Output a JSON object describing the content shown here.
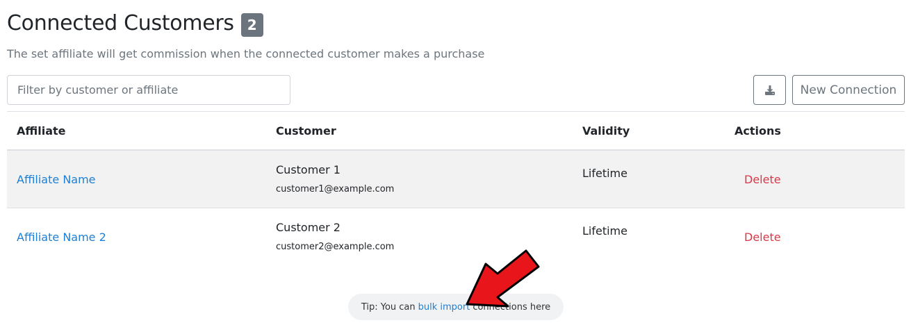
{
  "header": {
    "title": "Connected Customers",
    "count": "2",
    "subtitle": "The set affiliate will get commission when the connected customer makes a purchase"
  },
  "toolbar": {
    "filter_placeholder": "Filter by customer or affiliate",
    "download_icon": "download-icon",
    "new_connection_label": "New Connection"
  },
  "table": {
    "columns": [
      "Affiliate",
      "Customer",
      "Validity",
      "Actions"
    ],
    "rows": [
      {
        "affiliate": "Affiliate Name",
        "customer_name": "Customer 1",
        "customer_email": "customer1@example.com",
        "validity": "Lifetime",
        "action": "Delete"
      },
      {
        "affiliate": "Affiliate Name 2",
        "customer_name": "Customer 2",
        "customer_email": "customer2@example.com",
        "validity": "Lifetime",
        "action": "Delete"
      }
    ]
  },
  "tip": {
    "prefix": "Tip: You can",
    "link": "bulk import",
    "suffix": "connections here"
  },
  "colors": {
    "link": "#1c7fd6",
    "delete": "#dc3545",
    "badge": "#6c757d",
    "annotation_arrow": "#e8151b"
  }
}
